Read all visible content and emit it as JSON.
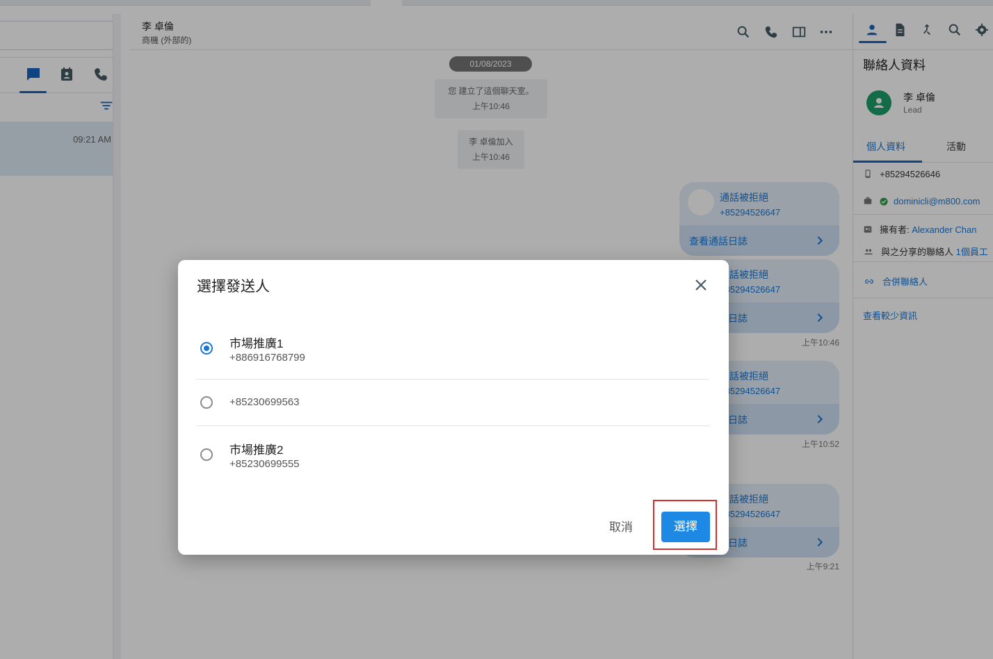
{
  "left_panel": {
    "conversation_time": "09:21 AM"
  },
  "chat": {
    "contact_name": "李 卓倫",
    "contact_subtitle": "商機 (外部的)",
    "date_separator": "01/08/2023",
    "system_messages": [
      {
        "text": "您 建立了這個聊天室。",
        "time": "上午10:46"
      },
      {
        "text": "李 卓倫加入",
        "time": "上午10:46"
      }
    ],
    "call_cards": [
      {
        "title": "通話被拒絕",
        "number": "+85294526647",
        "log_label": "查看通話日誌",
        "time": ""
      },
      {
        "title": "通話被拒絕",
        "number": "+85294526647",
        "log_label": "查看通話日誌",
        "time": "上午10:46"
      },
      {
        "title": "通話被拒絕",
        "number": "+85294526647",
        "log_label": "查看通話日誌",
        "time": "上午10:52"
      },
      {
        "title": "通話被拒絕",
        "number": "+85294526647",
        "log_label": "查看通話日誌",
        "time": "上午9:21"
      }
    ]
  },
  "right_panel": {
    "title": "聯絡人資料",
    "contact_name": "李 卓倫",
    "contact_type": "Lead",
    "tabs": [
      "個人資料",
      "活動"
    ],
    "phone": "+85294526646",
    "email": "dominicli@m800.com",
    "owner_label": "擁有者:",
    "owner_value": "Alexander Chan",
    "shared_label": "與之分享的聯絡人",
    "shared_value": "1個員工",
    "merge_label": "合併聯絡人",
    "less_info_label": "查看較少資訊"
  },
  "dialog": {
    "title": "選擇發送人",
    "options": [
      {
        "label": "市場推廣1",
        "number": "+886916768799",
        "selected": true
      },
      {
        "label": "",
        "number": "+85230699563",
        "selected": false
      },
      {
        "label": "市場推廣2",
        "number": "+85230699555",
        "selected": false
      }
    ],
    "cancel_label": "取消",
    "select_label": "選擇"
  },
  "colors": {
    "accent": "#1976d2",
    "primary_button": "#1e88e5",
    "highlight": "#d32f2f",
    "avatar": "#1e9e6a"
  }
}
